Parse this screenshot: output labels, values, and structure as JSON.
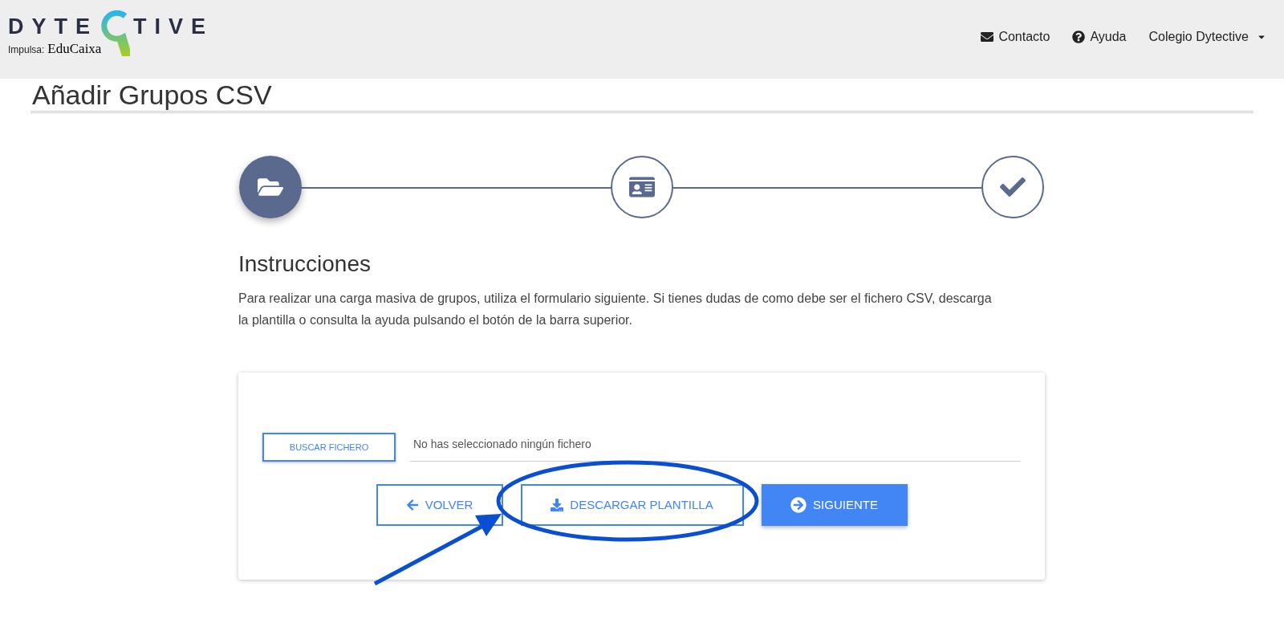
{
  "header": {
    "logo": {
      "left": "DYTE",
      "right": "TIVE",
      "sponsor_label": "Impulsa:",
      "sponsor": "EduCaixa"
    },
    "nav": [
      {
        "kind": "mail",
        "label": "Contacto"
      },
      {
        "kind": "help",
        "label": "Ayuda"
      },
      {
        "kind": "dropdown",
        "label": "Colegio Dytective"
      }
    ]
  },
  "page_title": "Añadir Grupos CSV",
  "steps": [
    {
      "kind": "folder",
      "active": true
    },
    {
      "kind": "card",
      "active": false
    },
    {
      "kind": "check",
      "active": false
    }
  ],
  "instructions": {
    "title": "Instrucciones",
    "text": "Para realizar una carga masiva de grupos, utiliza el formulario siguiente. Si tienes dudas de como debe ser el fichero CSV, descarga la plantilla o consulta la ayuda pulsando el botón de la barra superior."
  },
  "file_picker": {
    "button": "BUSCAR FICHERO",
    "value": "No has seleccionado ningún fichero"
  },
  "actions": [
    {
      "kind": "back",
      "label": "VOLVER",
      "primary": false
    },
    {
      "kind": "download",
      "label": "DESCARGAR PLANTILLA",
      "primary": false
    },
    {
      "kind": "next",
      "label": "SIGUIENTE",
      "primary": true
    }
  ]
}
